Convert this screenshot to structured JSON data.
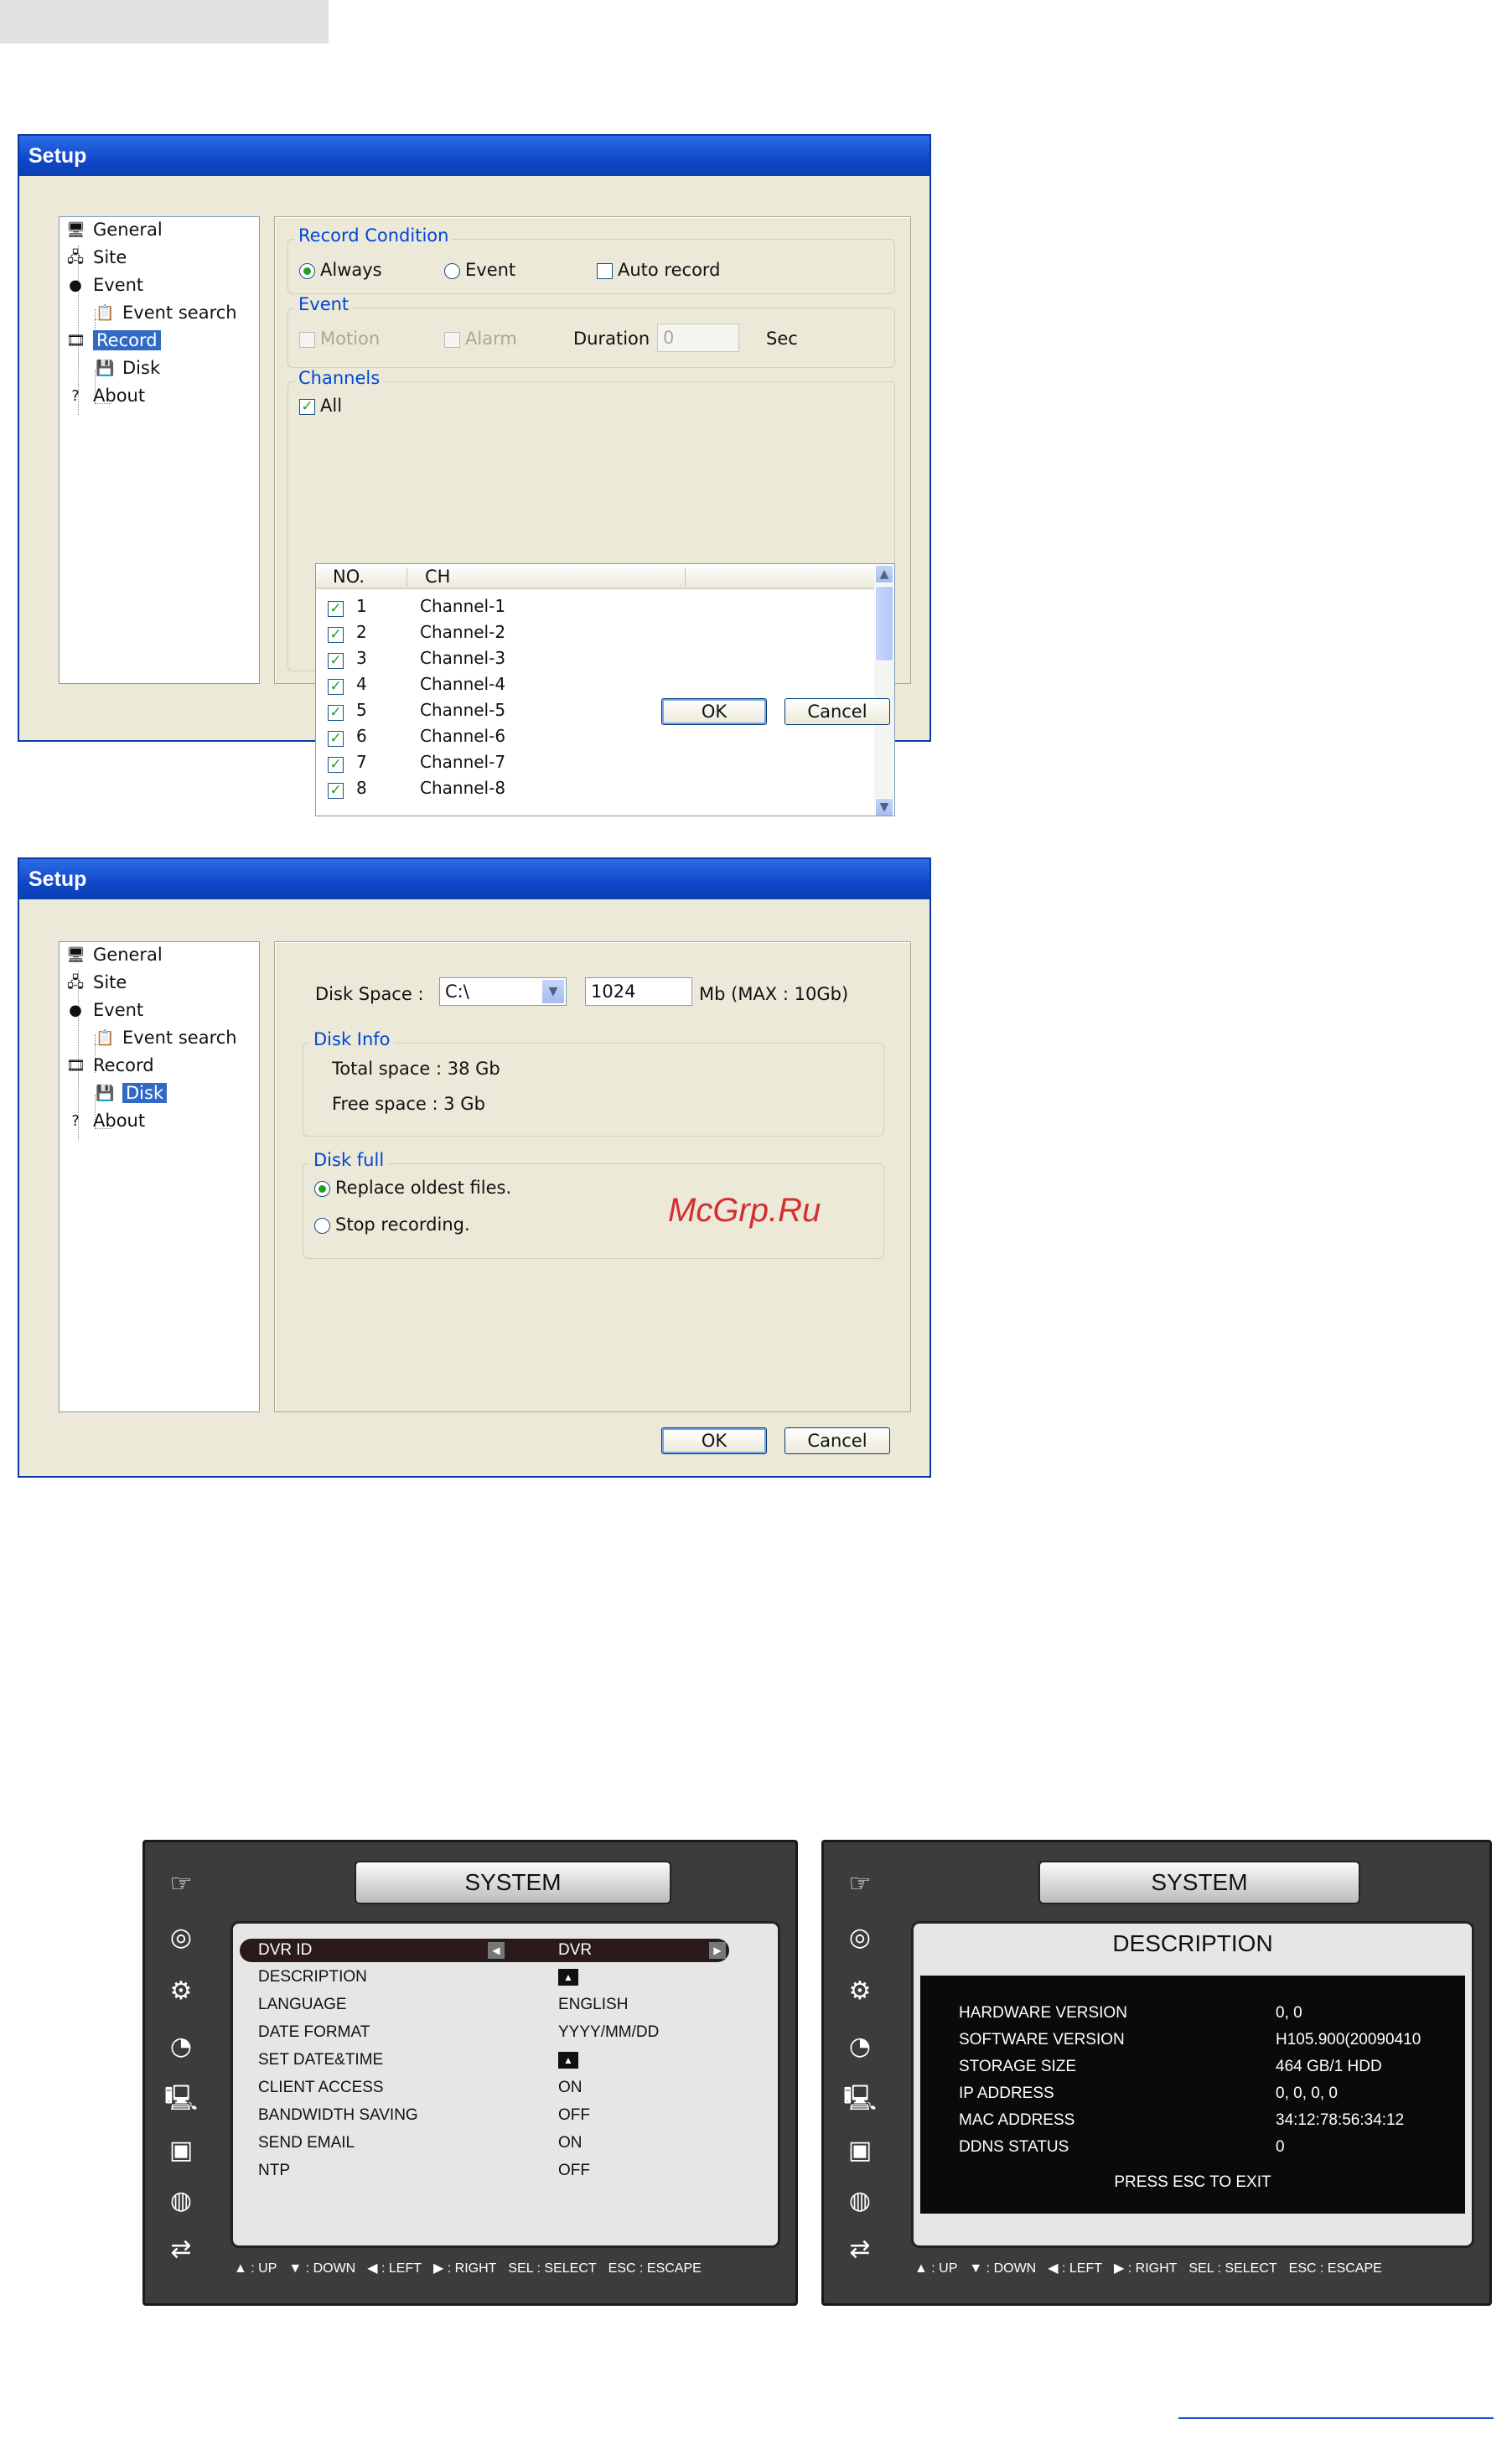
{
  "dialog1": {
    "title": "Setup",
    "tree": [
      "General",
      "Site",
      "Event",
      "Event search",
      "Record",
      "Disk",
      "About"
    ],
    "record_condition": {
      "legend": "Record Condition",
      "always": "Always",
      "event": "Event",
      "auto_record": "Auto record"
    },
    "event": {
      "legend": "Event",
      "motion": "Motion",
      "alarm": "Alarm",
      "duration_label": "Duration :",
      "duration_value": "0",
      "sec": "Sec"
    },
    "channels": {
      "legend": "Channels",
      "all": "All",
      "col_no": "NO.",
      "col_ch": "CH",
      "rows": [
        {
          "no": "1",
          "ch": "Channel-1"
        },
        {
          "no": "2",
          "ch": "Channel-2"
        },
        {
          "no": "3",
          "ch": "Channel-3"
        },
        {
          "no": "4",
          "ch": "Channel-4"
        },
        {
          "no": "5",
          "ch": "Channel-5"
        },
        {
          "no": "6",
          "ch": "Channel-6"
        },
        {
          "no": "7",
          "ch": "Channel-7"
        },
        {
          "no": "8",
          "ch": "Channel-8"
        }
      ]
    },
    "ok": "OK",
    "cancel": "Cancel"
  },
  "dialog2": {
    "title": "Setup",
    "tree": [
      "General",
      "Site",
      "Event",
      "Event search",
      "Record",
      "Disk",
      "About"
    ],
    "disk_space_label": "Disk Space :",
    "drive": "C:\\",
    "size": "1024",
    "max": "Mb (MAX : 10Gb)",
    "disk_info": {
      "legend": "Disk Info",
      "total": "Total space : 38 Gb",
      "free": "Free space : 3 Gb"
    },
    "disk_full": {
      "legend": "Disk full",
      "replace": "Replace oldest files.",
      "stop": "Stop recording."
    },
    "watermark": "McGrp.Ru",
    "ok": "OK",
    "cancel": "Cancel"
  },
  "osd1": {
    "title": "SYSTEM",
    "rows": [
      {
        "k": "DVR ID",
        "v": "DVR"
      },
      {
        "k": "DESCRIPTION",
        "v": "▲"
      },
      {
        "k": "LANGUAGE",
        "v": "ENGLISH"
      },
      {
        "k": "DATE FORMAT",
        "v": "YYYY/MM/DD"
      },
      {
        "k": "SET DATE&TIME",
        "v": "▲"
      },
      {
        "k": "CLIENT ACCESS",
        "v": "ON"
      },
      {
        "k": "BANDWIDTH SAVING",
        "v": "OFF"
      },
      {
        "k": "SEND EMAIL",
        "v": "ON"
      },
      {
        "k": "NTP",
        "v": "OFF"
      }
    ],
    "footer": [
      "▲ : UP",
      "▼ : DOWN",
      "◀ : LEFT",
      "▶ : RIGHT",
      "SEL : SELECT",
      "ESC : ESCAPE"
    ]
  },
  "osd2": {
    "title": "SYSTEM",
    "subtitle": "DESCRIPTION",
    "rows": [
      {
        "k": "HARDWARE VERSION",
        "v": "0, 0"
      },
      {
        "k": "SOFTWARE VERSION",
        "v": "H105.900(20090410"
      },
      {
        "k": "STORAGE SIZE",
        "v": "464 GB/1 HDD"
      },
      {
        "k": "IP ADDRESS",
        "v": "0, 0, 0, 0"
      },
      {
        "k": "MAC ADDRESS",
        "v": "34:12:78:56:34:12"
      },
      {
        "k": "DDNS STATUS",
        "v": "0"
      }
    ],
    "exit": "PRESS ESC TO EXIT",
    "footer": [
      "▲ : UP",
      "▼ : DOWN",
      "◀ : LEFT",
      "▶ : RIGHT",
      "SEL : SELECT",
      "ESC : ESCAPE"
    ]
  }
}
